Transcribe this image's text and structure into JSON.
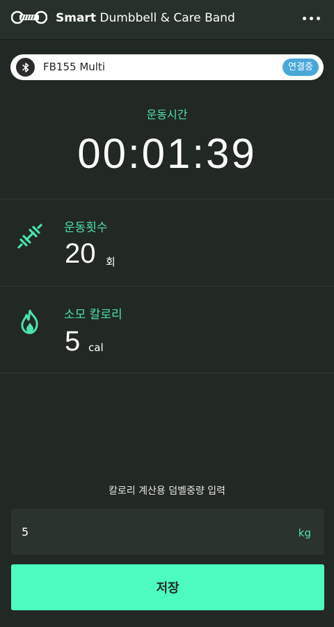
{
  "header": {
    "title_bold": "Smart",
    "title_rest": "Dumbbell & Care Band",
    "logo_icon": "dumbbell-logo-icon",
    "menu_icon": "more-horizontal-icon"
  },
  "device": {
    "icon": "bluetooth-icon",
    "name": "FB155 Multi",
    "status": "연결중",
    "status_color": "#4aa7d9"
  },
  "timer": {
    "label": "운동시간",
    "value": "00:01:39"
  },
  "stats": {
    "reps": {
      "icon": "dumbbell-icon",
      "label": "운동횟수",
      "value": "20",
      "unit": "회"
    },
    "calories": {
      "icon": "flame-icon",
      "label": "소모 칼로리",
      "value": "5",
      "unit": "cal"
    }
  },
  "weight": {
    "label": "칼로리 계산용 덤벨중량 입력",
    "value": "5",
    "unit": "kg"
  },
  "save_button": {
    "label": "저장"
  },
  "colors": {
    "accent": "#4be3b0",
    "button": "#4bfbc0",
    "background": "#222823"
  }
}
